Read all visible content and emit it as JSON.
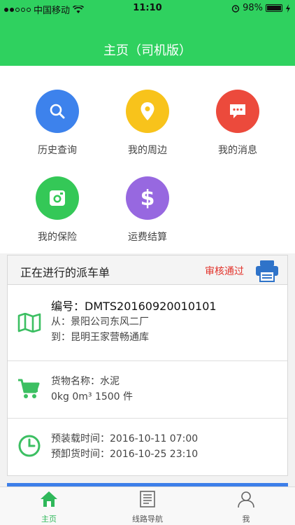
{
  "status_bar": {
    "carrier": "中国移动",
    "time": "11:10",
    "battery": "98%",
    "battery_level": 0.98
  },
  "header": {
    "title": "主页（司机版）"
  },
  "menu": [
    {
      "label": "历史查询",
      "icon": "search-icon",
      "color": "#3d82ec"
    },
    {
      "label": "我的周边",
      "icon": "location-pin-icon",
      "color": "#f8c31b"
    },
    {
      "label": "我的消息",
      "icon": "message-icon",
      "color": "#ec4a3c"
    },
    {
      "label": "我的保险",
      "icon": "camera-icon",
      "color": "#34c857"
    },
    {
      "label": "运费结算",
      "icon": "dollar-icon",
      "color": "#9768e0"
    }
  ],
  "order": {
    "title": "正在进行的派车单",
    "status": "审核通过",
    "number": "编号：DMTS20160920010101",
    "from": "从：景阳公司东风二厂",
    "to": "到：昆明王家营畅通库",
    "goods_name": "货物名称：水泥",
    "goods_spec": "0kg  0m³  1500 件",
    "load_time": "预装载时间：2016-10-11 07:00",
    "unload_time": "预卸货时间：2016-10-25 23:10"
  },
  "tabs": [
    {
      "label": "主页",
      "icon": "home-icon",
      "active": true
    },
    {
      "label": "线路导航",
      "icon": "document-icon",
      "active": false
    },
    {
      "label": "我",
      "icon": "user-icon",
      "active": false
    }
  ],
  "colors": {
    "green": "#2fd15f",
    "red": "#e2332b",
    "blue": "#3d7fe9"
  }
}
